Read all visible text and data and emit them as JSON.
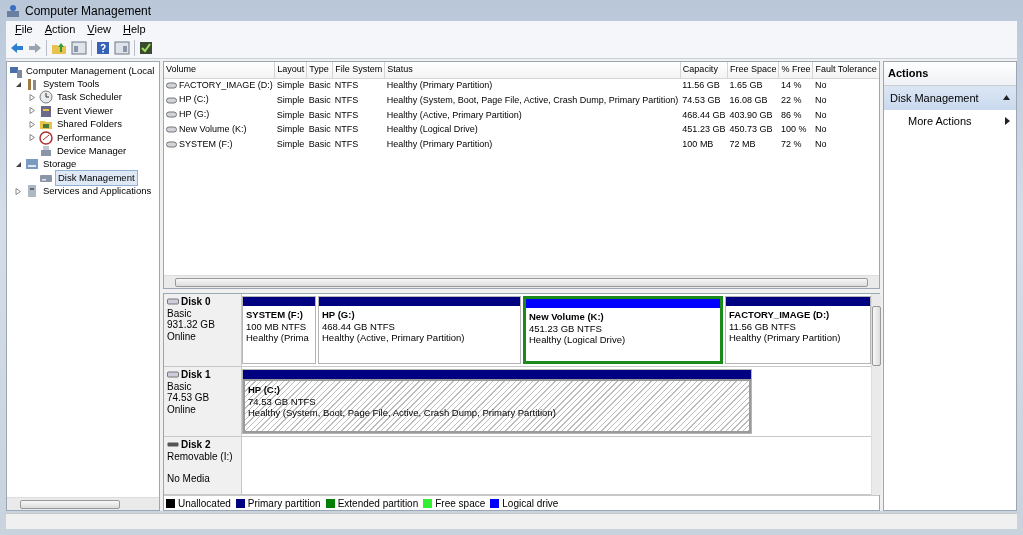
{
  "window": {
    "title": "Computer Management"
  },
  "menu": [
    {
      "label": "File"
    },
    {
      "label": "Action"
    },
    {
      "label": "View"
    },
    {
      "label": "Help"
    }
  ],
  "tree": [
    {
      "label": "Computer Management (Local",
      "selected": false,
      "children": [
        {
          "label": "System Tools",
          "selected": false,
          "expanded": true,
          "children": [
            {
              "label": "Task Scheduler",
              "selected": false,
              "expanded": false
            },
            {
              "label": "Event Viewer",
              "selected": false,
              "expanded": false
            },
            {
              "label": "Shared Folders",
              "selected": false,
              "expanded": false
            },
            {
              "label": "Performance",
              "selected": false,
              "expanded": false
            },
            {
              "label": "Device Manager",
              "selected": false
            }
          ]
        },
        {
          "label": "Storage",
          "selected": false,
          "expanded": true,
          "children": [
            {
              "label": "Disk Management",
              "selected": true
            }
          ]
        },
        {
          "label": "Services and Applications",
          "selected": false,
          "expanded": false
        }
      ]
    }
  ],
  "table": {
    "columns": [
      "Volume",
      "Layout",
      "Type",
      "File System",
      "Status",
      "Capacity",
      "Free Space",
      "% Free",
      "Fault Tolerance"
    ],
    "rows": [
      [
        "FACTORY_IMAGE (D:)",
        "Simple",
        "Basic",
        "NTFS",
        "Healthy (Primary Partition)",
        "11.56 GB",
        "1.65 GB",
        "14 %",
        "No"
      ],
      [
        "HP (C:)",
        "Simple",
        "Basic",
        "NTFS",
        "Healthy (System, Boot, Page File, Active, Crash Dump, Primary Partition)",
        "74.53 GB",
        "16.08 GB",
        "22 %",
        "No"
      ],
      [
        "HP (G:)",
        "Simple",
        "Basic",
        "NTFS",
        "Healthy (Active, Primary Partition)",
        "468.44 GB",
        "403.90 GB",
        "86 %",
        "No"
      ],
      [
        "New Volume (K:)",
        "Simple",
        "Basic",
        "NTFS",
        "Healthy (Logical Drive)",
        "451.23 GB",
        "450.73 GB",
        "100 %",
        "No"
      ],
      [
        "SYSTEM (F:)",
        "Simple",
        "Basic",
        "NTFS",
        "Healthy (Primary Partition)",
        "100 MB",
        "72 MB",
        "72 %",
        "No"
      ]
    ]
  },
  "disks": [
    {
      "name": "Disk 0",
      "kind": "fixed",
      "type": "Basic",
      "size": "931.32 GB",
      "status": "Online",
      "partitions": [
        {
          "name": "SYSTEM  (F:)",
          "info": "100 MB NTFS",
          "status": "Healthy (Prima",
          "kind": "primary",
          "selected": false
        },
        {
          "name": "HP  (G:)",
          "info": "468.44 GB NTFS",
          "status": "Healthy (Active, Primary Partition)",
          "kind": "primary",
          "selected": false
        },
        {
          "name": "New Volume  (K:)",
          "info": "451.23 GB NTFS",
          "status": "Healthy (Logical Drive)",
          "kind": "logical",
          "selected": false
        },
        {
          "name": "FACTORY_IMAGE  (D:)",
          "info": "11.56 GB NTFS",
          "status": "Healthy (Primary Partition)",
          "kind": "primary",
          "selected": false
        }
      ]
    },
    {
      "name": "Disk 1",
      "kind": "fixed",
      "type": "Basic",
      "size": "74.53 GB",
      "status": "Online",
      "partitions": [
        {
          "name": "HP  (C:)",
          "info": "74.53 GB NTFS",
          "status": "Healthy (System, Boot, Page File, Active, Crash Dump, Primary Partition)",
          "kind": "primary",
          "selected": true
        }
      ]
    },
    {
      "name": "Disk 2",
      "type": "Removable (I:)",
      "status": "No Media",
      "kind": "removable"
    }
  ],
  "legend": [
    {
      "label": "Unallocated",
      "color": "#000000"
    },
    {
      "label": "Primary partition",
      "color": "#000080"
    },
    {
      "label": "Extended partition",
      "color": "#008000"
    },
    {
      "label": "Free space",
      "color": "#33ee33"
    },
    {
      "label": "Logical drive",
      "color": "#0000ff"
    }
  ],
  "actions": {
    "title": "Actions",
    "section": {
      "label": "Disk Management",
      "expanded": true
    },
    "items": [
      "More Actions"
    ]
  }
}
